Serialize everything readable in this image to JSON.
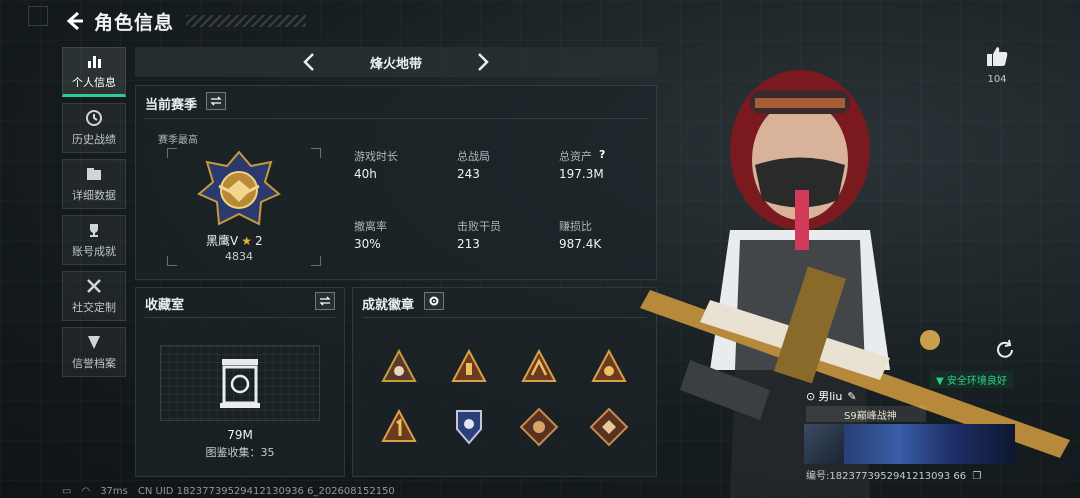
{
  "header": {
    "title": "角色信息"
  },
  "sidebar": {
    "items": [
      {
        "label": "个人信息",
        "active": true,
        "icon": "bar-chart-icon"
      },
      {
        "label": "历史战绩",
        "icon": "history-icon"
      },
      {
        "label": "详细数据",
        "icon": "folder-icon"
      },
      {
        "label": "账号成就",
        "icon": "trophy-icon"
      },
      {
        "label": "社交定制",
        "icon": "tools-icon"
      },
      {
        "label": "信誉档案",
        "icon": "shield-icon"
      }
    ]
  },
  "mode_selector": {
    "label": "烽火地带"
  },
  "season": {
    "title": "当前赛季",
    "best_label": "赛季最高",
    "rank_name": "黑鹰Ⅴ",
    "rank_stars": "2",
    "rank_score": "4834",
    "stats": [
      {
        "label": "游戏时长",
        "value": "40h"
      },
      {
        "label": "总战局",
        "value": "243"
      },
      {
        "label": "总资产",
        "value": "197.3M"
      },
      {
        "label": "撤离率",
        "value": "30%"
      },
      {
        "label": "击败干员",
        "value": "213"
      },
      {
        "label": "赚损比",
        "value": "987.4K"
      }
    ]
  },
  "collection": {
    "title": "收藏室",
    "value": "79M",
    "count_label": "图鉴收集：35"
  },
  "badges": {
    "title": "成就徽章",
    "items": [
      "badge-1",
      "badge-2",
      "badge-3",
      "badge-4",
      "badge-5",
      "badge-6",
      "badge-7",
      "badge-8"
    ]
  },
  "profile": {
    "likes": "104",
    "env_tag": "安全环境良好",
    "player_name": "男liu",
    "title": "S9巅峰战神",
    "player_id": "编号:1823773952941213093 66"
  },
  "status_bar": {
    "ping": "37ms",
    "uid": "CN UID 18237739529412130936 6_202608152150"
  },
  "colors": {
    "accent": "#2ecf8e",
    "gold": "#c79a3c",
    "badge_bg": "#4a2f22"
  }
}
